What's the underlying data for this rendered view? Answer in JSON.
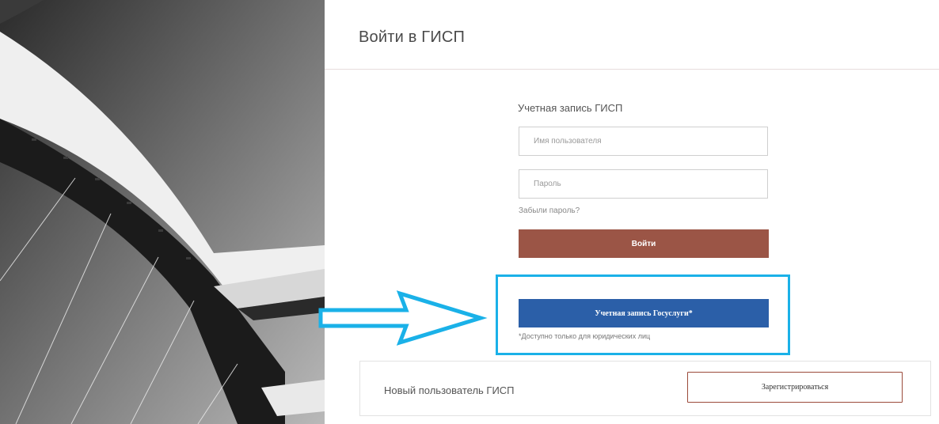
{
  "page": {
    "title": "Войти в ГИСП"
  },
  "login_form": {
    "heading": "Учетная запись ГИСП",
    "username_placeholder": "Имя пользователя",
    "password_placeholder": "Пароль",
    "forgot_password": "Забыли пароль?",
    "login_button": "Войти"
  },
  "gosuslugi": {
    "button_label": "Учетная запись Госуслуги*",
    "note": "*Доступно только для юридических лиц"
  },
  "registration": {
    "label": "Новый пользователь ГИСП",
    "button_label": "Зарегистрироваться"
  },
  "colors": {
    "login_button": "#9b5546",
    "gosuslugi_button": "#2b5fa8",
    "highlight": "#1ab1e8",
    "register_border": "#9b4a3a"
  },
  "icons": {
    "annotation_arrow": "right-arrow-outline",
    "background": "bridge-arch-photo"
  }
}
